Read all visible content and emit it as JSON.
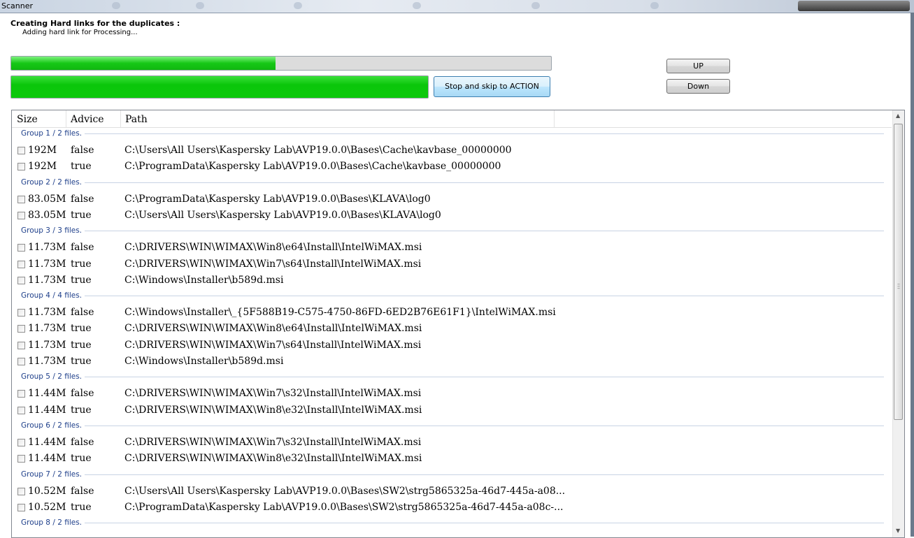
{
  "window": {
    "title": "Scanner"
  },
  "status": {
    "heading": "Creating Hard links for the duplicates :",
    "subheading": "Adding hard link for Processing..."
  },
  "progress": {
    "overall": 0.49,
    "current": 1.0
  },
  "buttons": {
    "stop": "Stop and skip to ACTION",
    "up": "UP",
    "down": "Down"
  },
  "columns": {
    "size": "Size",
    "advice": "Advice",
    "path": "Path"
  },
  "groups": [
    {
      "label": "Group 1 / 2 files.",
      "rows": [
        {
          "size": "192M",
          "advice": "false",
          "path": "C:\\Users\\All Users\\Kaspersky Lab\\AVP19.0.0\\Bases\\Cache\\kavbase_00000000"
        },
        {
          "size": "192M",
          "advice": "true",
          "path": "C:\\ProgramData\\Kaspersky Lab\\AVP19.0.0\\Bases\\Cache\\kavbase_00000000"
        }
      ]
    },
    {
      "label": "Group 2 / 2 files.",
      "rows": [
        {
          "size": "83.05M",
          "advice": "false",
          "path": "C:\\ProgramData\\Kaspersky Lab\\AVP19.0.0\\Bases\\KLAVA\\log0"
        },
        {
          "size": "83.05M",
          "advice": "true",
          "path": "C:\\Users\\All Users\\Kaspersky Lab\\AVP19.0.0\\Bases\\KLAVA\\log0"
        }
      ]
    },
    {
      "label": "Group 3 / 3 files.",
      "rows": [
        {
          "size": "11.73M",
          "advice": "false",
          "path": "C:\\DRIVERS\\WIN\\WIMAX\\Win8\\e64\\Install\\IntelWiMAX.msi"
        },
        {
          "size": "11.73M",
          "advice": "true",
          "path": "C:\\DRIVERS\\WIN\\WIMAX\\Win7\\s64\\Install\\IntelWiMAX.msi"
        },
        {
          "size": "11.73M",
          "advice": "true",
          "path": "C:\\Windows\\Installer\\b589d.msi"
        }
      ]
    },
    {
      "label": "Group 4 / 4 files.",
      "rows": [
        {
          "size": "11.73M",
          "advice": "false",
          "path": "C:\\Windows\\Installer\\_{5F588B19-C575-4750-86FD-6ED2B76E61F1}\\IntelWiMAX.msi"
        },
        {
          "size": "11.73M",
          "advice": "true",
          "path": "C:\\DRIVERS\\WIN\\WIMAX\\Win8\\e64\\Install\\IntelWiMAX.msi"
        },
        {
          "size": "11.73M",
          "advice": "true",
          "path": "C:\\DRIVERS\\WIN\\WIMAX\\Win7\\s64\\Install\\IntelWiMAX.msi"
        },
        {
          "size": "11.73M",
          "advice": "true",
          "path": "C:\\Windows\\Installer\\b589d.msi"
        }
      ]
    },
    {
      "label": "Group 5 / 2 files.",
      "rows": [
        {
          "size": "11.44M",
          "advice": "false",
          "path": "C:\\DRIVERS\\WIN\\WIMAX\\Win7\\s32\\Install\\IntelWiMAX.msi"
        },
        {
          "size": "11.44M",
          "advice": "true",
          "path": "C:\\DRIVERS\\WIN\\WIMAX\\Win8\\e32\\Install\\IntelWiMAX.msi"
        }
      ]
    },
    {
      "label": "Group 6 / 2 files.",
      "rows": [
        {
          "size": "11.44M",
          "advice": "false",
          "path": "C:\\DRIVERS\\WIN\\WIMAX\\Win7\\s32\\Install\\IntelWiMAX.msi"
        },
        {
          "size": "11.44M",
          "advice": "true",
          "path": "C:\\DRIVERS\\WIN\\WIMAX\\Win8\\e32\\Install\\IntelWiMAX.msi"
        }
      ]
    },
    {
      "label": "Group 7 / 2 files.",
      "rows": [
        {
          "size": "10.52M",
          "advice": "false",
          "path": "C:\\Users\\All Users\\Kaspersky Lab\\AVP19.0.0\\Bases\\SW2\\strg5865325a-46d7-445a-a08..."
        },
        {
          "size": "10.52M",
          "advice": "true",
          "path": "C:\\ProgramData\\Kaspersky Lab\\AVP19.0.0\\Bases\\SW2\\strg5865325a-46d7-445a-a08c-..."
        }
      ]
    },
    {
      "label": "Group 8 / 2 files.",
      "rows": []
    }
  ]
}
